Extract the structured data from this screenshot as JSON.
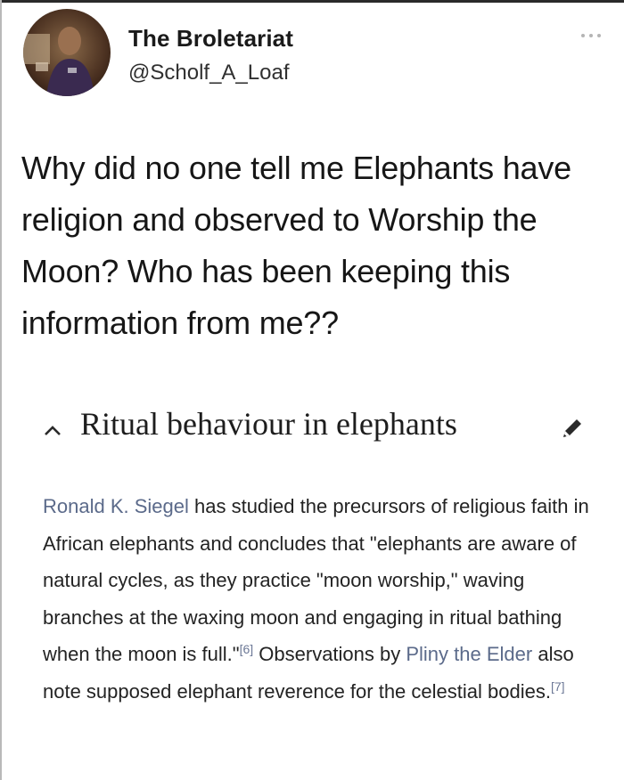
{
  "tweet": {
    "author_name": "The Broletariat",
    "author_handle": "@Scholf_A_Loaf",
    "text": "Why did no one tell me Elephants have religion and observed to Worship the Moon? Who has been keeping this information from me??"
  },
  "wiki": {
    "section_title": "Ritual behaviour in elephants",
    "paragraph": {
      "link1": "Ronald K. Siegel",
      "part1": " has studied the precursors of religious faith in African elephants and concludes that \"elephants are aware of natural cycles, as they practice \"moon worship,\" waving branches at the waxing moon and engaging in ritual bathing when the moon is full.\"",
      "ref1": "[6]",
      "part2": " Observations by ",
      "link2": "Pliny the Elder",
      "part3": " also note supposed elephant reverence for the celestial bodies.",
      "ref2": "[7]"
    }
  },
  "icons": {
    "more": "more-icon",
    "collapse": "chevron-up-icon",
    "edit": "pencil-icon"
  },
  "colors": {
    "link": "#5b6a8a",
    "text": "#161616"
  }
}
